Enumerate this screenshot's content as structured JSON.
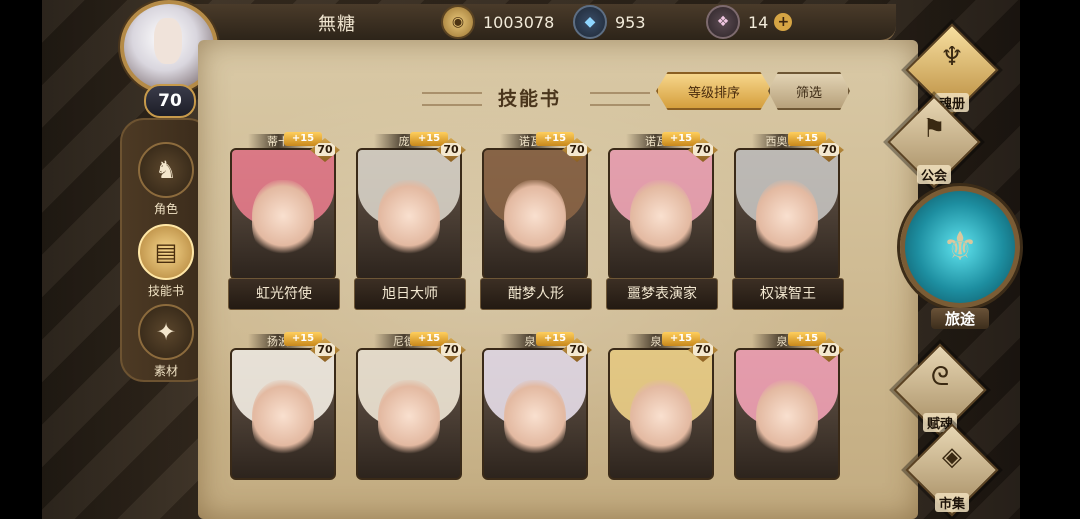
{
  "header": {
    "username": "無糖",
    "player_level": "70",
    "currencies": [
      {
        "name": "coin",
        "icon": "coin-icon",
        "value": "1003078"
      },
      {
        "name": "gem",
        "icon": "blue-crystal-icon",
        "value": "953"
      },
      {
        "name": "crystal",
        "icon": "pink-crystal-icon",
        "value": "14"
      }
    ],
    "add_symbol": "+"
  },
  "left_nav": [
    {
      "label": "角色",
      "icon": "helmet-icon",
      "active": false
    },
    {
      "label": "技能书",
      "icon": "book-icon",
      "active": true
    },
    {
      "label": "素材",
      "icon": "crest-icon",
      "active": false
    }
  ],
  "panel": {
    "title": "技能书",
    "sort_label": "等级排序",
    "filter_label": "筛选"
  },
  "cards": [
    {
      "tag": "蒂卡",
      "name": "虹光符使",
      "plus": "+15",
      "level": "70",
      "hair": "#e77c8c"
    },
    {
      "tag": "庞",
      "name": "旭日大师",
      "plus": "+15",
      "level": "70",
      "hair": "#d8d3c8"
    },
    {
      "tag": "诺瓦",
      "name": "酣梦人形",
      "plus": "+15",
      "level": "70",
      "hair": "#8b6546"
    },
    {
      "tag": "诺瓦",
      "name": "噩梦表演家",
      "plus": "+15",
      "level": "70",
      "hair": "#f1a6b7"
    },
    {
      "tag": "西奥多",
      "name": "权谋智王",
      "plus": "+15",
      "level": "70",
      "hair": "#c5c3c0"
    },
    {
      "tag": "扬波",
      "name": "",
      "plus": "+15",
      "level": "70",
      "hair": "#f5efe5"
    },
    {
      "tag": "尼德",
      "name": "",
      "plus": "+15",
      "level": "70",
      "hair": "#efe7d6"
    },
    {
      "tag": "泉",
      "name": "",
      "plus": "+15",
      "level": "70",
      "hair": "#e8dfea"
    },
    {
      "tag": "泉",
      "name": "",
      "plus": "+15",
      "level": "70",
      "hair": "#f0d38a"
    },
    {
      "tag": "泉",
      "name": "",
      "plus": "+15",
      "level": "70",
      "hair": "#f2a3b6"
    }
  ],
  "right_nav": [
    {
      "label": "魂册",
      "icon": "soul-book-icon",
      "glyph": "♆",
      "active": true
    },
    {
      "label": "公会",
      "icon": "guild-icon",
      "glyph": "⚑",
      "active": false
    },
    {
      "label": "赋魂",
      "icon": "swirl-icon",
      "glyph": "ᘓ",
      "active": false
    },
    {
      "label": "市集",
      "icon": "market-icon",
      "glyph": "◈",
      "active": false
    }
  ],
  "journey": {
    "label": "旅途",
    "icon": "trident-emblem-icon",
    "glyph": "⚜"
  }
}
